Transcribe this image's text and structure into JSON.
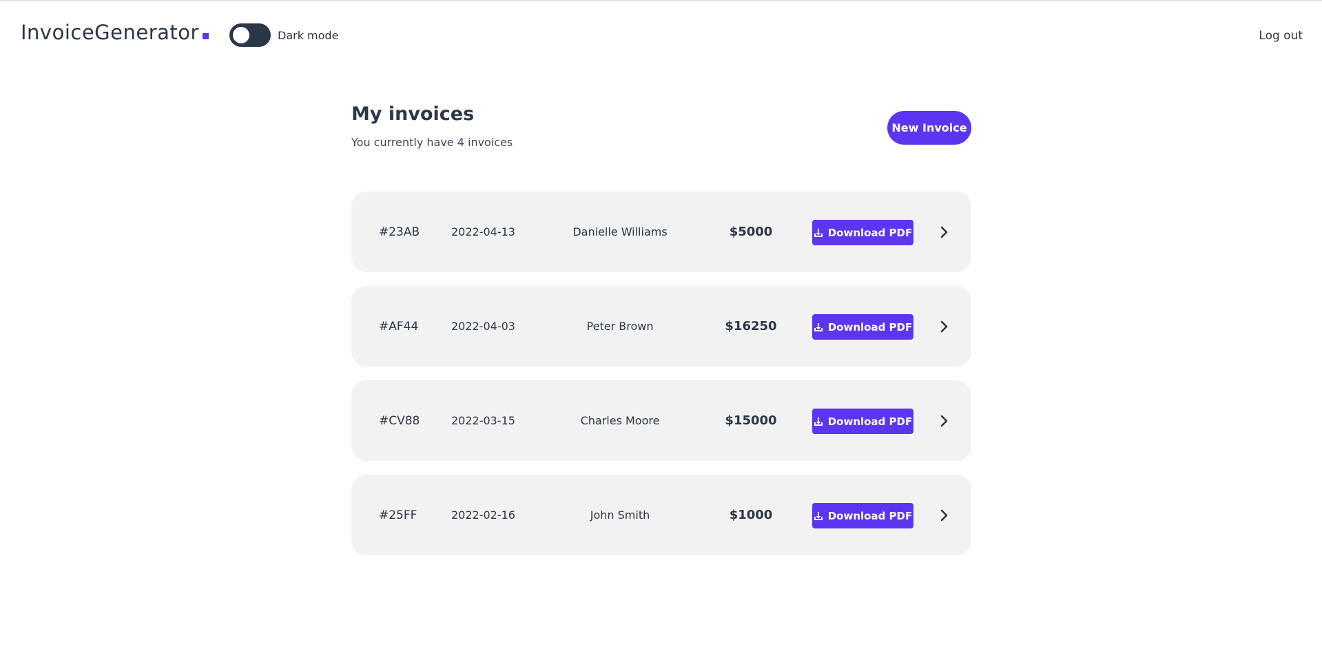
{
  "header": {
    "logo_text": "InvoiceGenerator",
    "dark_mode_label": "Dark mode",
    "dark_mode_on": false,
    "logout_label": "Log out"
  },
  "main": {
    "title": "My invoices",
    "subtitle": "You currently have 4 invoices",
    "new_invoice_label": "New Invoice"
  },
  "invoices": [
    {
      "id": "#23AB",
      "date": "2022-04-13",
      "client": "Danielle Williams",
      "amount": "$5000",
      "download_label": "Download PDF"
    },
    {
      "id": "#AF44",
      "date": "2022-04-03",
      "client": "Peter Brown",
      "amount": "$16250",
      "download_label": "Download PDF"
    },
    {
      "id": "#CV88",
      "date": "2022-03-15",
      "client": "Charles Moore",
      "amount": "$15000",
      "download_label": "Download PDF"
    },
    {
      "id": "#25FF",
      "date": "2022-02-16",
      "client": "John Smith",
      "amount": "$1000",
      "download_label": "Download PDF"
    }
  ],
  "icons": {
    "download": "download-icon",
    "chevron": "chevron-right-icon"
  },
  "colors": {
    "accent": "#5b35f0",
    "text": "#2b3646",
    "card_bg": "#f2f2f2"
  }
}
